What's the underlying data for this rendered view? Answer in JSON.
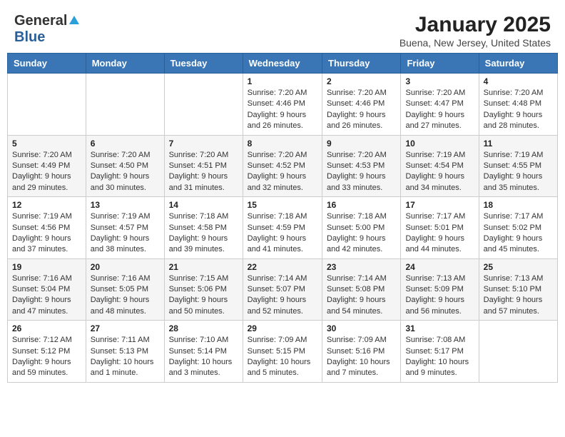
{
  "logo": {
    "general": "General",
    "blue": "Blue"
  },
  "title": "January 2025",
  "subtitle": "Buena, New Jersey, United States",
  "headers": [
    "Sunday",
    "Monday",
    "Tuesday",
    "Wednesday",
    "Thursday",
    "Friday",
    "Saturday"
  ],
  "weeks": [
    [
      {
        "date": "",
        "info": ""
      },
      {
        "date": "",
        "info": ""
      },
      {
        "date": "",
        "info": ""
      },
      {
        "date": "1",
        "info": "Sunrise: 7:20 AM\nSunset: 4:46 PM\nDaylight: 9 hours and 26 minutes."
      },
      {
        "date": "2",
        "info": "Sunrise: 7:20 AM\nSunset: 4:46 PM\nDaylight: 9 hours and 26 minutes."
      },
      {
        "date": "3",
        "info": "Sunrise: 7:20 AM\nSunset: 4:47 PM\nDaylight: 9 hours and 27 minutes."
      },
      {
        "date": "4",
        "info": "Sunrise: 7:20 AM\nSunset: 4:48 PM\nDaylight: 9 hours and 28 minutes."
      }
    ],
    [
      {
        "date": "5",
        "info": "Sunrise: 7:20 AM\nSunset: 4:49 PM\nDaylight: 9 hours and 29 minutes."
      },
      {
        "date": "6",
        "info": "Sunrise: 7:20 AM\nSunset: 4:50 PM\nDaylight: 9 hours and 30 minutes."
      },
      {
        "date": "7",
        "info": "Sunrise: 7:20 AM\nSunset: 4:51 PM\nDaylight: 9 hours and 31 minutes."
      },
      {
        "date": "8",
        "info": "Sunrise: 7:20 AM\nSunset: 4:52 PM\nDaylight: 9 hours and 32 minutes."
      },
      {
        "date": "9",
        "info": "Sunrise: 7:20 AM\nSunset: 4:53 PM\nDaylight: 9 hours and 33 minutes."
      },
      {
        "date": "10",
        "info": "Sunrise: 7:19 AM\nSunset: 4:54 PM\nDaylight: 9 hours and 34 minutes."
      },
      {
        "date": "11",
        "info": "Sunrise: 7:19 AM\nSunset: 4:55 PM\nDaylight: 9 hours and 35 minutes."
      }
    ],
    [
      {
        "date": "12",
        "info": "Sunrise: 7:19 AM\nSunset: 4:56 PM\nDaylight: 9 hours and 37 minutes."
      },
      {
        "date": "13",
        "info": "Sunrise: 7:19 AM\nSunset: 4:57 PM\nDaylight: 9 hours and 38 minutes."
      },
      {
        "date": "14",
        "info": "Sunrise: 7:18 AM\nSunset: 4:58 PM\nDaylight: 9 hours and 39 minutes."
      },
      {
        "date": "15",
        "info": "Sunrise: 7:18 AM\nSunset: 4:59 PM\nDaylight: 9 hours and 41 minutes."
      },
      {
        "date": "16",
        "info": "Sunrise: 7:18 AM\nSunset: 5:00 PM\nDaylight: 9 hours and 42 minutes."
      },
      {
        "date": "17",
        "info": "Sunrise: 7:17 AM\nSunset: 5:01 PM\nDaylight: 9 hours and 44 minutes."
      },
      {
        "date": "18",
        "info": "Sunrise: 7:17 AM\nSunset: 5:02 PM\nDaylight: 9 hours and 45 minutes."
      }
    ],
    [
      {
        "date": "19",
        "info": "Sunrise: 7:16 AM\nSunset: 5:04 PM\nDaylight: 9 hours and 47 minutes."
      },
      {
        "date": "20",
        "info": "Sunrise: 7:16 AM\nSunset: 5:05 PM\nDaylight: 9 hours and 48 minutes."
      },
      {
        "date": "21",
        "info": "Sunrise: 7:15 AM\nSunset: 5:06 PM\nDaylight: 9 hours and 50 minutes."
      },
      {
        "date": "22",
        "info": "Sunrise: 7:14 AM\nSunset: 5:07 PM\nDaylight: 9 hours and 52 minutes."
      },
      {
        "date": "23",
        "info": "Sunrise: 7:14 AM\nSunset: 5:08 PM\nDaylight: 9 hours and 54 minutes."
      },
      {
        "date": "24",
        "info": "Sunrise: 7:13 AM\nSunset: 5:09 PM\nDaylight: 9 hours and 56 minutes."
      },
      {
        "date": "25",
        "info": "Sunrise: 7:13 AM\nSunset: 5:10 PM\nDaylight: 9 hours and 57 minutes."
      }
    ],
    [
      {
        "date": "26",
        "info": "Sunrise: 7:12 AM\nSunset: 5:12 PM\nDaylight: 9 hours and 59 minutes."
      },
      {
        "date": "27",
        "info": "Sunrise: 7:11 AM\nSunset: 5:13 PM\nDaylight: 10 hours and 1 minute."
      },
      {
        "date": "28",
        "info": "Sunrise: 7:10 AM\nSunset: 5:14 PM\nDaylight: 10 hours and 3 minutes."
      },
      {
        "date": "29",
        "info": "Sunrise: 7:09 AM\nSunset: 5:15 PM\nDaylight: 10 hours and 5 minutes."
      },
      {
        "date": "30",
        "info": "Sunrise: 7:09 AM\nSunset: 5:16 PM\nDaylight: 10 hours and 7 minutes."
      },
      {
        "date": "31",
        "info": "Sunrise: 7:08 AM\nSunset: 5:17 PM\nDaylight: 10 hours and 9 minutes."
      },
      {
        "date": "",
        "info": ""
      }
    ]
  ]
}
